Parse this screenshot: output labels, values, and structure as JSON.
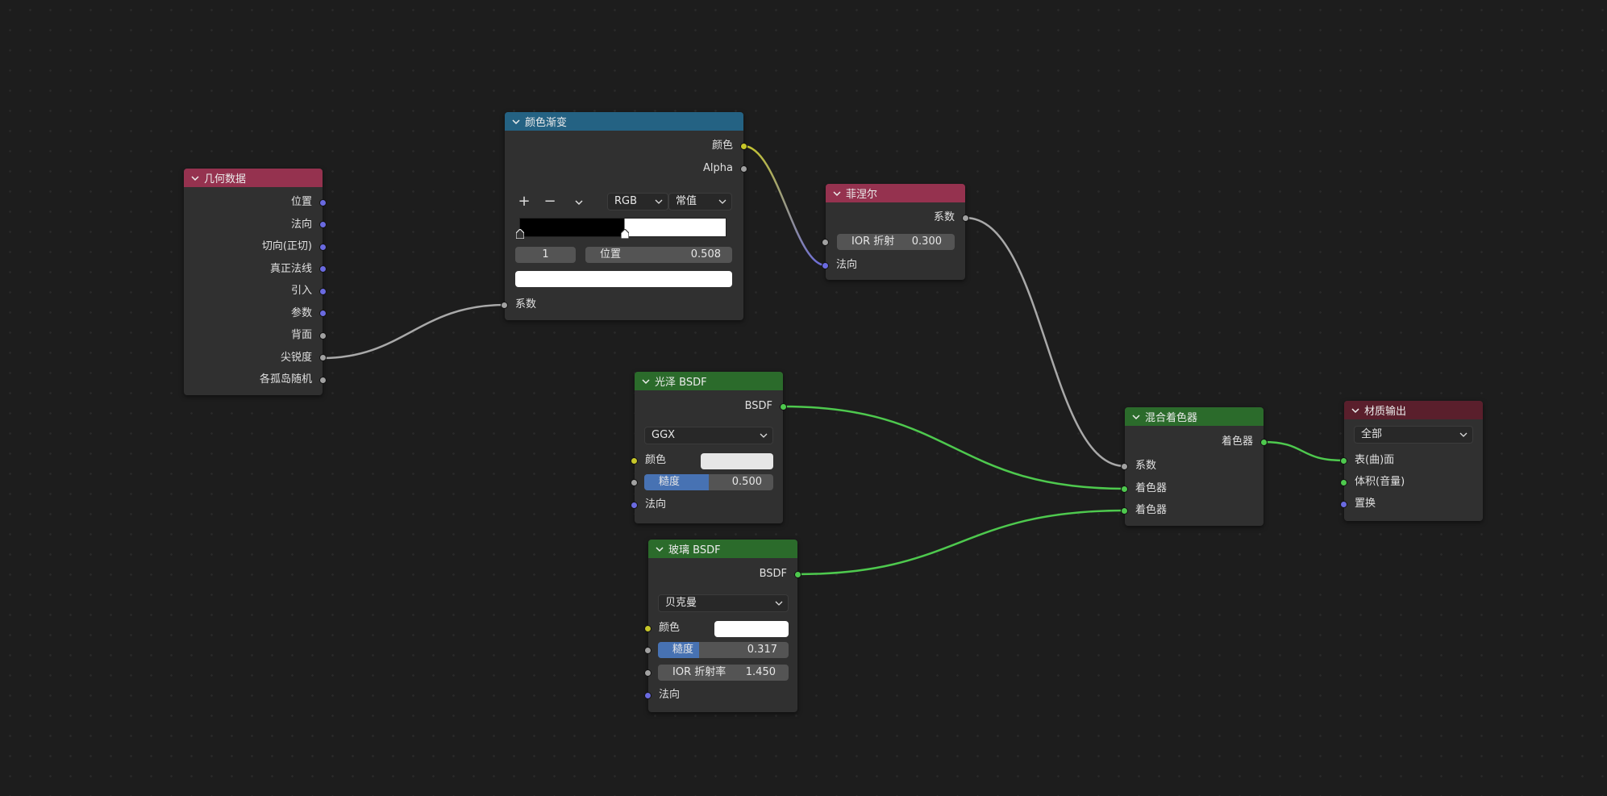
{
  "colors": {
    "geometry_header": "#95324f",
    "colorramp_header": "#246283",
    "fresnel_header": "#95324f",
    "shader_header": "#2b6b2b",
    "output_header": "#5a1f2c",
    "slider_fill": "#4772b3"
  },
  "geometry": {
    "title": "几何数据",
    "outputs": [
      "位置",
      "法向",
      "切向(正切)",
      "真正法线",
      "引入",
      "参数",
      "背面",
      "尖锐度",
      "各孤岛随机"
    ]
  },
  "color_ramp": {
    "title": "颜色渐变",
    "output_color": "颜色",
    "output_alpha": "Alpha",
    "add": "+",
    "remove": "−",
    "mode": "RGB",
    "interpolation": "常值",
    "stop_index": "1",
    "position_label": "位置",
    "position_value": "0.508",
    "input_fac": "系数"
  },
  "fresnel": {
    "title": "菲涅尔",
    "output_fac": "系数",
    "ior_label": "IOR 折射",
    "ior_value": "0.300",
    "input_normal": "法向"
  },
  "glossy": {
    "title": "光泽 BSDF",
    "output": "BSDF",
    "distribution": "GGX",
    "color_label": "颜色",
    "roughness_label": "糙度",
    "roughness_value": "0.500",
    "roughness_fraction": 0.5,
    "normal_label": "法向"
  },
  "glass": {
    "title": "玻璃 BSDF",
    "output": "BSDF",
    "distribution": "贝克曼",
    "color_label": "颜色",
    "roughness_label": "糙度",
    "roughness_value": "0.317",
    "roughness_fraction": 0.317,
    "ior_label": "IOR 折射率",
    "ior_value": "1.450",
    "normal_label": "法向"
  },
  "mix": {
    "title": "混合着色器",
    "output": "着色器",
    "input_fac": "系数",
    "input_shader1": "着色器",
    "input_shader2": "着色器"
  },
  "output": {
    "title": "材质输出",
    "target": "全部",
    "input_surface": "表(曲)面",
    "input_volume": "体积(音量)",
    "input_displacement": "置换"
  }
}
